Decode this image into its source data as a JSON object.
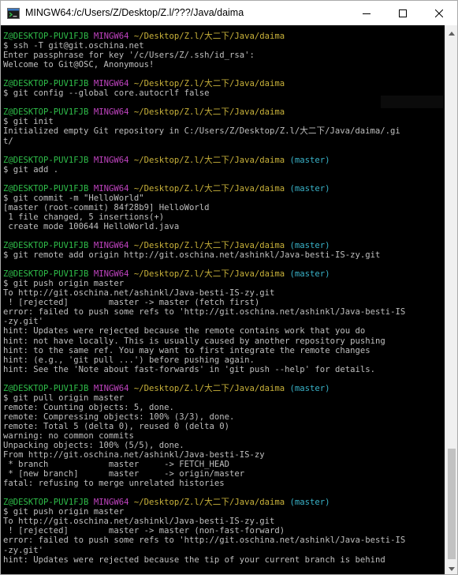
{
  "window": {
    "title": "MINGW64:/c/Users/Z/Desktop/Z.l/???/Java/daima"
  },
  "terminal": {
    "prompt": {
      "user_host": "Z@DESKTOP-PUV1FJB",
      "shell": "MINGW64",
      "path_home": "~/Desktop/Z.l/大二下/Java/daima",
      "branch": "(master)"
    },
    "lines": [
      {
        "type": "prompt",
        "branch": false
      },
      {
        "type": "text",
        "text": "$ ssh -T git@git.oschina.net"
      },
      {
        "type": "text",
        "text": "Enter passphrase for key '/c/Users/Z/.ssh/id_rsa':"
      },
      {
        "type": "text",
        "text": "Welcome to Git@OSC, Anonymous!"
      },
      {
        "type": "blank"
      },
      {
        "type": "prompt",
        "branch": false
      },
      {
        "type": "text",
        "text": "$ git config --global core.autocrlf false"
      },
      {
        "type": "blank"
      },
      {
        "type": "prompt",
        "branch": false
      },
      {
        "type": "text",
        "text": "$ git init"
      },
      {
        "type": "text",
        "text": "Initialized empty Git repository in C:/Users/Z/Desktop/Z.l/大二下/Java/daima/.gi"
      },
      {
        "type": "text",
        "text": "t/"
      },
      {
        "type": "blank"
      },
      {
        "type": "prompt",
        "branch": true
      },
      {
        "type": "text",
        "text": "$ git add ."
      },
      {
        "type": "blank"
      },
      {
        "type": "prompt",
        "branch": true
      },
      {
        "type": "text",
        "text": "$ git commit -m \"HelloWorld\""
      },
      {
        "type": "text",
        "text": "[master (root-commit) 84f28b9] HelloWorld"
      },
      {
        "type": "text",
        "text": " 1 file changed, 5 insertions(+)"
      },
      {
        "type": "text",
        "text": " create mode 100644 HelloWorld.java"
      },
      {
        "type": "blank"
      },
      {
        "type": "prompt",
        "branch": true
      },
      {
        "type": "text",
        "text": "$ git remote add origin http://git.oschina.net/ashinkl/Java-besti-IS-zy.git"
      },
      {
        "type": "blank"
      },
      {
        "type": "prompt",
        "branch": true
      },
      {
        "type": "text",
        "text": "$ git push origin master"
      },
      {
        "type": "text",
        "text": "To http://git.oschina.net/ashinkl/Java-besti-IS-zy.git"
      },
      {
        "type": "text",
        "text": " ! [rejected]        master -> master (fetch first)"
      },
      {
        "type": "text",
        "text": "error: failed to push some refs to 'http://git.oschina.net/ashinkl/Java-besti-IS"
      },
      {
        "type": "text",
        "text": "-zy.git'"
      },
      {
        "type": "text",
        "text": "hint: Updates were rejected because the remote contains work that you do"
      },
      {
        "type": "text",
        "text": "hint: not have locally. This is usually caused by another repository pushing"
      },
      {
        "type": "text",
        "text": "hint: to the same ref. You may want to first integrate the remote changes"
      },
      {
        "type": "text",
        "text": "hint: (e.g., 'git pull ...') before pushing again."
      },
      {
        "type": "text",
        "text": "hint: See the 'Note about fast-forwards' in 'git push --help' for details."
      },
      {
        "type": "blank"
      },
      {
        "type": "prompt",
        "branch": true
      },
      {
        "type": "text",
        "text": "$ git pull origin master"
      },
      {
        "type": "text",
        "text": "remote: Counting objects: 5, done."
      },
      {
        "type": "text",
        "text": "remote: Compressing objects: 100% (3/3), done."
      },
      {
        "type": "text",
        "text": "remote: Total 5 (delta 0), reused 0 (delta 0)"
      },
      {
        "type": "text",
        "text": "warning: no common commits"
      },
      {
        "type": "text",
        "text": "Unpacking objects: 100% (5/5), done."
      },
      {
        "type": "text",
        "text": "From http://git.oschina.net/ashinkl/Java-besti-IS-zy"
      },
      {
        "type": "text",
        "text": " * branch            master     -> FETCH_HEAD"
      },
      {
        "type": "text",
        "text": " * [new branch]      master     -> origin/master"
      },
      {
        "type": "text",
        "text": "fatal: refusing to merge unrelated histories"
      },
      {
        "type": "blank"
      },
      {
        "type": "prompt",
        "branch": true
      },
      {
        "type": "text",
        "text": "$ git push origin master"
      },
      {
        "type": "text",
        "text": "To http://git.oschina.net/ashinkl/Java-besti-IS-zy.git"
      },
      {
        "type": "text",
        "text": " ! [rejected]        master -> master (non-fast-forward)"
      },
      {
        "type": "text",
        "text": "error: failed to push some refs to 'http://git.oschina.net/ashinkl/Java-besti-IS"
      },
      {
        "type": "text",
        "text": "-zy.git'"
      },
      {
        "type": "text",
        "text": "hint: Updates were rejected because the tip of your current branch is behind"
      }
    ]
  },
  "icons": {
    "app": "mingw-terminal-icon",
    "minimize": "minimize-icon",
    "maximize": "maximize-icon",
    "close": "close-icon",
    "scroll_up": "scroll-up-arrow-icon",
    "scroll_down": "scroll-down-arrow-icon"
  },
  "colors": {
    "background": "#000000",
    "text": "#bfbfbf",
    "user_host": "#2fbf4a",
    "shell": "#bf43bf",
    "path": "#c9b23a",
    "branch": "#39b3c9"
  }
}
